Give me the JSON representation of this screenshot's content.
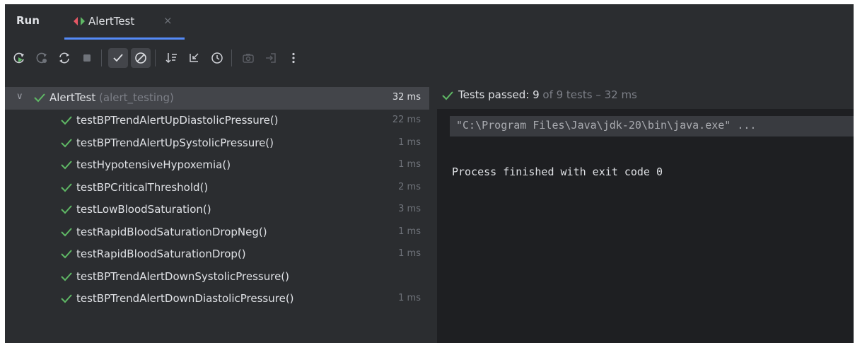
{
  "header": {
    "run_label": "Run",
    "tab_label": "AlertTest",
    "tab_close": "×"
  },
  "toolbar": {
    "buttons": [
      "rerun-icon",
      "rerun-failed-icon",
      "toggle-auto-test-icon",
      "stop-icon",
      "show-passed-icon",
      "show-ignored-icon",
      "sort-icon",
      "collapse-icon",
      "history-icon",
      "screenshot-icon",
      "export-icon",
      "more-icon"
    ]
  },
  "tree": {
    "root": {
      "name": "AlertTest",
      "package": "(alert_testing)",
      "duration": "32 ms"
    },
    "tests": [
      {
        "name": "testBPTrendAlertUpDiastolicPressure()",
        "duration": "22 ms"
      },
      {
        "name": "testBPTrendAlertUpSystolicPressure()",
        "duration": "1 ms"
      },
      {
        "name": "testHypotensiveHypoxemia()",
        "duration": "1 ms"
      },
      {
        "name": "testBPCriticalThreshold()",
        "duration": "2 ms"
      },
      {
        "name": "testLowBloodSaturation()",
        "duration": "3 ms"
      },
      {
        "name": "testRapidBloodSaturationDropNeg()",
        "duration": "1 ms"
      },
      {
        "name": "testRapidBloodSaturationDrop()",
        "duration": "1 ms"
      },
      {
        "name": "testBPTrendAlertDownSystolicPressure()",
        "duration": ""
      },
      {
        "name": "testBPTrendAlertDownDiastolicPressure()",
        "duration": "1 ms"
      }
    ]
  },
  "console": {
    "status_label": "Tests passed:",
    "passed_count": "9",
    "status_suffix": "of 9 tests – 32 ms",
    "command": "\"C:\\Program Files\\Java\\jdk-20\\bin\\java.exe\" ...",
    "exit_message": "Process finished with exit code 0"
  },
  "colors": {
    "pass": "#5fb865",
    "accent": "#548af7",
    "background": "#2b2d30",
    "console_bg": "#1e1f22"
  }
}
